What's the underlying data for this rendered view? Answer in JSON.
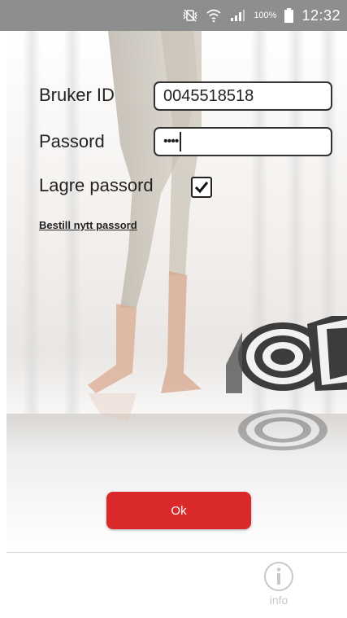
{
  "status_bar": {
    "battery_percent": "100%",
    "time": "12:32",
    "icons": [
      "mute-vibrate-icon",
      "wifi-icon",
      "signal-icon",
      "battery-icon"
    ]
  },
  "login": {
    "user_id_label": "Bruker ID",
    "user_id_value": "0045518518",
    "password_label": "Passord",
    "password_masked": "••••",
    "save_password_label": "Lagre passord",
    "save_password_checked": true,
    "forgot_password_link": "Bestill nytt passord"
  },
  "actions": {
    "ok_label": "Ok"
  },
  "bottom_bar": {
    "info_label": "info"
  },
  "colors": {
    "status_bar": "#8e8e8e",
    "ok_button": "#d9292b",
    "text": "#222222",
    "info_icon": "#c8c8c8"
  }
}
